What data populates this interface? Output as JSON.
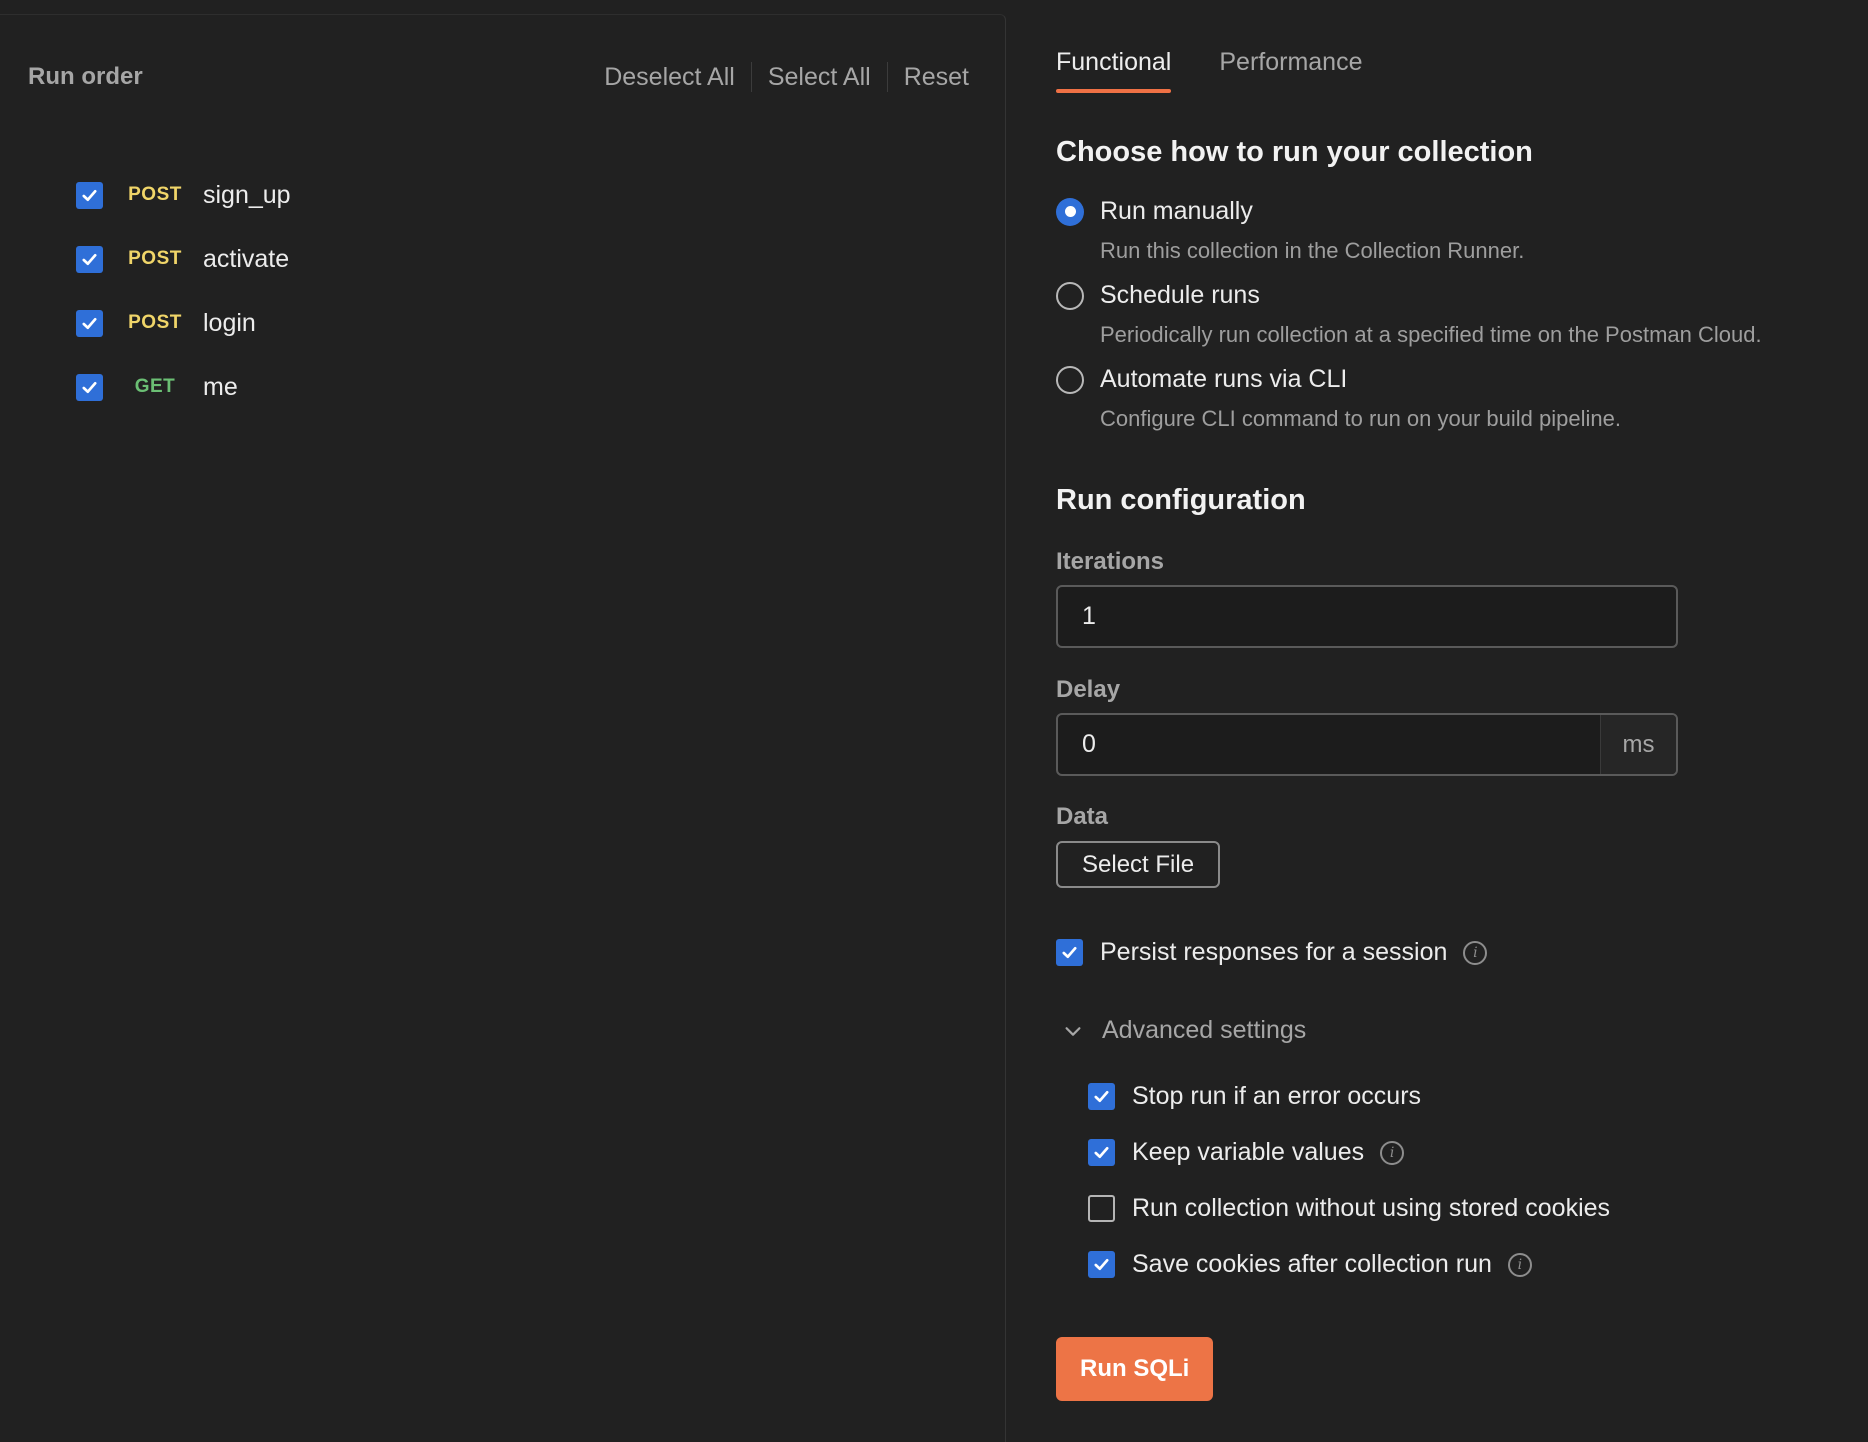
{
  "run_order": {
    "title": "Run order",
    "actions": [
      "Deselect All",
      "Select All",
      "Reset"
    ],
    "requests": [
      {
        "method": "POST",
        "name": "sign_up",
        "checked": true
      },
      {
        "method": "POST",
        "name": "activate",
        "checked": true
      },
      {
        "method": "POST",
        "name": "login",
        "checked": true
      },
      {
        "method": "GET",
        "name": "me",
        "checked": true
      }
    ]
  },
  "tabs": [
    "Functional",
    "Performance"
  ],
  "how_to_run": {
    "title": "Choose how to run your collection",
    "options": [
      {
        "label": "Run manually",
        "desc": "Run this collection in the Collection Runner.",
        "selected": true
      },
      {
        "label": "Schedule runs",
        "desc": "Periodically run collection at a specified time on the Postman Cloud.",
        "selected": false
      },
      {
        "label": "Automate runs via CLI",
        "desc": "Configure CLI command to run on your build pipeline.",
        "selected": false
      }
    ]
  },
  "run_config": {
    "title": "Run configuration",
    "iterations_label": "Iterations",
    "iterations_value": "1",
    "delay_label": "Delay",
    "delay_value": "0",
    "delay_unit": "ms",
    "data_label": "Data",
    "select_file_label": "Select File",
    "persist_label": "Persist responses for a session",
    "persist_checked": true
  },
  "advanced": {
    "label": "Advanced settings",
    "options": [
      {
        "label": "Stop run if an error occurs",
        "checked": true,
        "info": false
      },
      {
        "label": "Keep variable values",
        "checked": true,
        "info": true
      },
      {
        "label": "Run collection without using stored cookies",
        "checked": false,
        "info": false
      },
      {
        "label": "Save cookies after collection run",
        "checked": true,
        "info": true
      }
    ]
  },
  "run_button_label": "Run SQLi",
  "colors": {
    "accent": "#ED7446",
    "checkbox": "#2F6FD8",
    "post": "#F0D569",
    "get": "#6BBF74"
  },
  "icons": {
    "checkbox_checked": "checkmark-icon",
    "info": "info-icon",
    "advanced_toggle": "chevron-down-icon"
  }
}
